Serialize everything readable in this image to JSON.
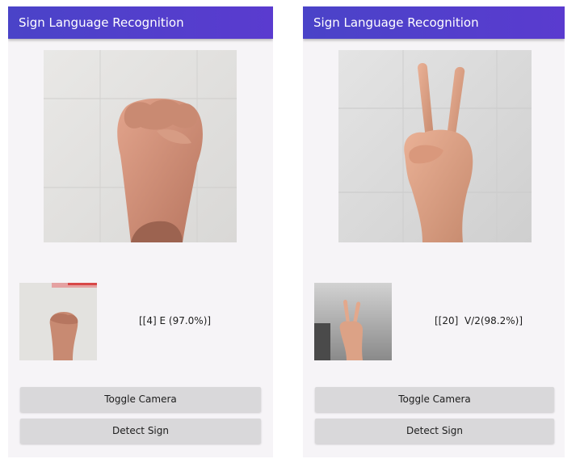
{
  "left_screen": {
    "app_title": "Sign Language Recognition",
    "prediction_text": "[[4] E (97.0%)]",
    "toggle_camera_label": "Toggle Camera",
    "detect_sign_label": "Detect Sign",
    "preview_image": "hand-sign-e-photo",
    "thumbnail_image": "hand-sign-e-thumbnail"
  },
  "right_screen": {
    "app_title": "Sign Language Recognition",
    "prediction_text": "[[20]  V/2(98.2%)]",
    "toggle_camera_label": "Toggle Camera",
    "detect_sign_label": "Detect Sign",
    "preview_image": "hand-sign-v-photo",
    "thumbnail_image": "hand-sign-v-thumbnail"
  },
  "colors": {
    "app_bar": "#4a43c8",
    "background": "#f6f4f7",
    "button": "#d9d8da",
    "text": "#1c1c1c"
  }
}
